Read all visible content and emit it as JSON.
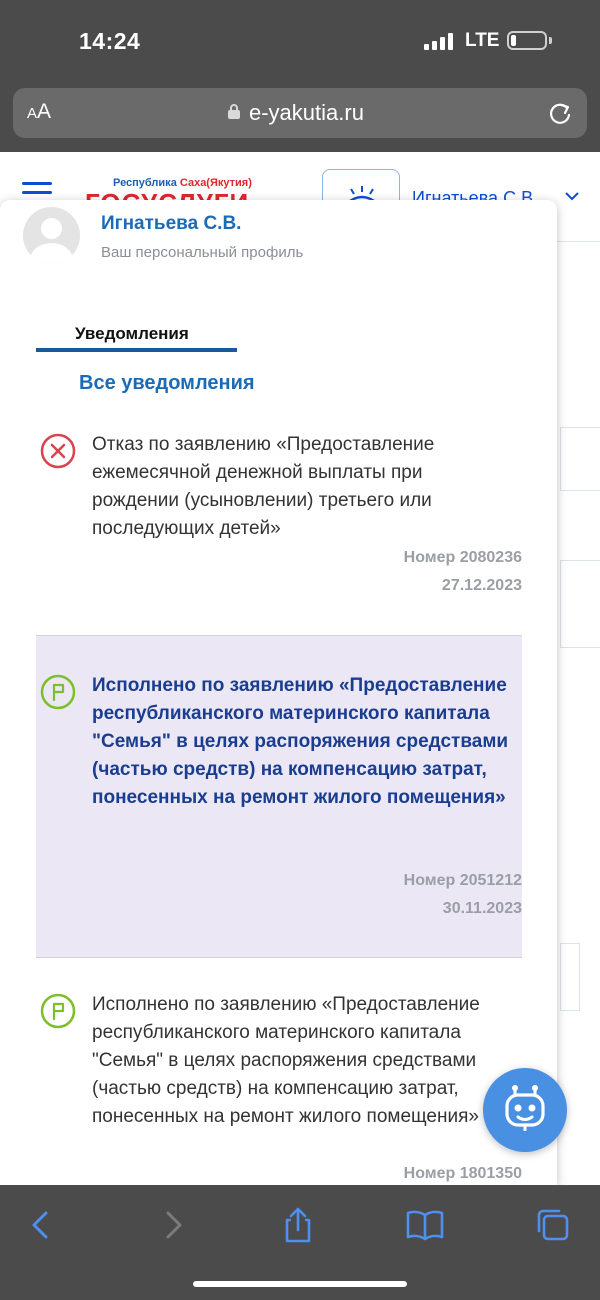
{
  "status_bar": {
    "time": "14:24",
    "network": "LTE"
  },
  "browser": {
    "text_size_label": "AA",
    "url": "e-yakutia.ru",
    "icons": [
      "lock-icon",
      "reload-icon",
      "back-icon",
      "forward-icon",
      "share-icon",
      "bookmarks-icon",
      "tabs-icon"
    ]
  },
  "site_header": {
    "region_prefix": "Республика ",
    "region_name": "Саха(Якутия)",
    "logo_text": "ГОСУСЛУГИ",
    "user_name": "Игнатьева С.В."
  },
  "profile": {
    "name": "Игнатьева С.В.",
    "subtitle": "Ваш персональный профиль"
  },
  "tabs": {
    "active": "Уведомления"
  },
  "all_notifications_link": "Все уведомления",
  "colors": {
    "link_blue": "#1a6bb8",
    "reject_red": "#d9434e",
    "done_green": "#7cbf2a",
    "highlight_bg": "#ece7f4",
    "fab_blue": "#4a90e2"
  },
  "notifications": [
    {
      "status": "rejected",
      "icon": "reject-x-icon",
      "text": "Отказ по заявлению «Предоставление ежемесячной денежной выплаты при рождении (усыновлении) третьего или последующих детей»",
      "number": "Номер 2080236",
      "date": "27.12.2023",
      "highlighted": false
    },
    {
      "status": "completed",
      "icon": "flag-icon",
      "text": "Исполнено по заявлению «Предоставление республиканского материнского капитала \"Семья\" в целях распоряжения средствами (частью средств) на компенсацию затрат, понесенных на ремонт жилого помещения»",
      "number": "Номер 2051212",
      "date": "30.11.2023",
      "highlighted": true
    },
    {
      "status": "completed",
      "icon": "flag-icon",
      "text": "Исполнено по заявлению «Предоставление республиканского материнского капитала \"Семья\" в целях распоряжения средствами (частью средств) на компенсацию затрат, понесенных на ремонт жилого помещения»",
      "number": "Номер 1801350",
      "date": "",
      "highlighted": false
    }
  ]
}
